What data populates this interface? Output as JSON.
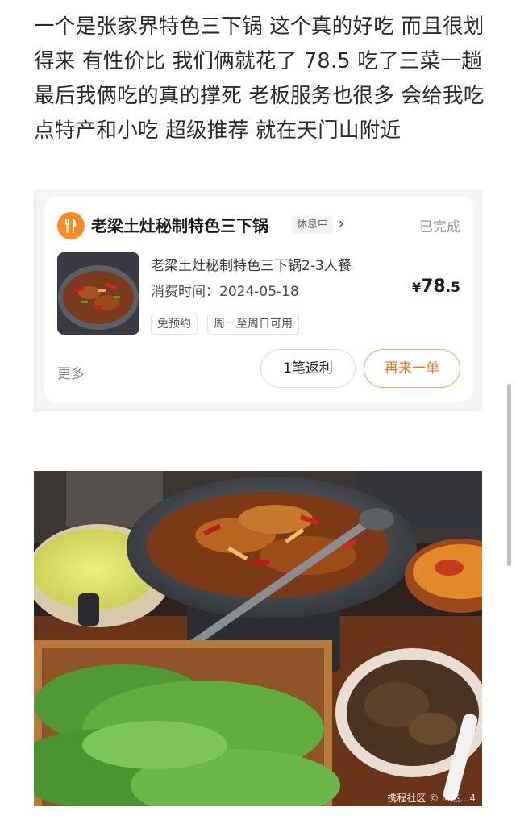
{
  "post": {
    "text": "一个是张家界特色三下锅 这个真的好吃 而且很划得来 有性价比 我们俩就花了 78.5 吃了三菜一趟 最后我俩吃的真的撑死 老板服务也很多 会给我吃点特产和小吃 超级推荐 就在天门山附近"
  },
  "order_card": {
    "shop_icon": "fork-knife-icon",
    "shop_name": "老梁土灶秘制特色三下锅",
    "rest_badge": "休息中",
    "chevron": "›",
    "status": "已完成",
    "item_title": "老梁土灶秘制特色三下锅2-3人餐",
    "time_label": "消费时间：",
    "time_value": "2024-05-18",
    "price_currency": "¥",
    "price_int": "78",
    "price_dec": ".5",
    "tags": [
      "免预约",
      "周一至周日可用"
    ],
    "more": "更多",
    "refund_button": "1笔返利",
    "reorder_button": "再来一单"
  },
  "photo": {
    "watermark": "携程社区 © M杰…4"
  },
  "colors": {
    "accent": "#f0751e",
    "shop_icon_bg": "#ff8a1f"
  }
}
